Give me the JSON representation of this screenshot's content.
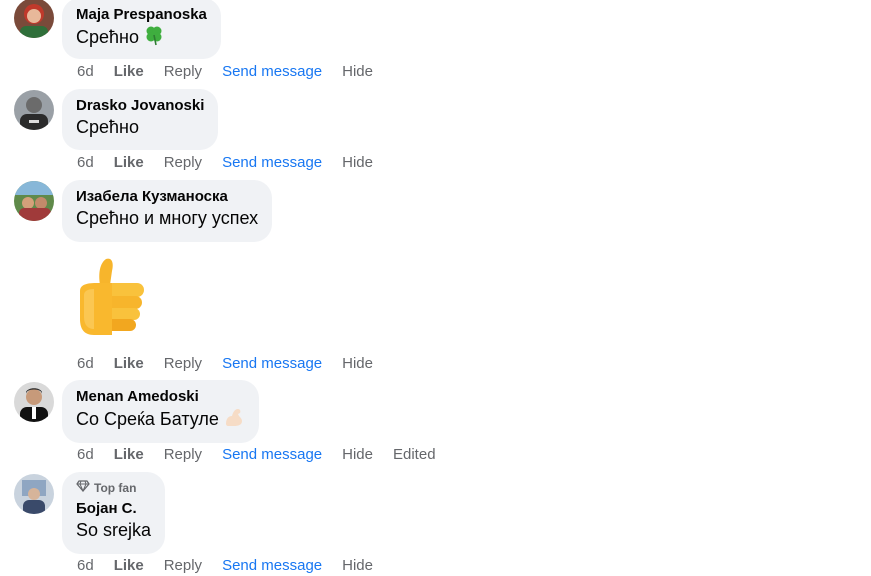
{
  "comments": [
    {
      "author": "Maja Prespanoska",
      "text": "Срећно",
      "emoji": "clover-icon",
      "actions": {
        "time": "6d",
        "like": "Like",
        "reply": "Reply",
        "send": "Send message",
        "hide": "Hide"
      }
    },
    {
      "author": "Drasko Jovanoski",
      "text": "Срећно",
      "actions": {
        "time": "6d",
        "like": "Like",
        "reply": "Reply",
        "send": "Send message",
        "hide": "Hide"
      }
    },
    {
      "author": "Изабела Кузманоска",
      "text": "Срећно и многу успех",
      "sticker": "thumbs-up-icon",
      "actions": {
        "time": "6d",
        "like": "Like",
        "reply": "Reply",
        "send": "Send message",
        "hide": "Hide"
      }
    },
    {
      "author": "Menan Amedoski",
      "text": "Со Среќа Батуле",
      "emoji": "flexed-biceps-icon",
      "actions": {
        "time": "6d",
        "like": "Like",
        "reply": "Reply",
        "send": "Send message",
        "hide": "Hide",
        "edited": "Edited"
      }
    },
    {
      "badge": "Top fan",
      "badge_icon": "diamond-icon",
      "author": "Бојан С.",
      "text": "So srejka",
      "actions": {
        "time": "6d",
        "like": "Like",
        "reply": "Reply",
        "send": "Send message",
        "hide": "Hide"
      }
    }
  ],
  "colors": {
    "bubble": "#f0f2f5",
    "secondary_text": "#65676b",
    "link": "#1877f2",
    "primary_text": "#050505"
  }
}
